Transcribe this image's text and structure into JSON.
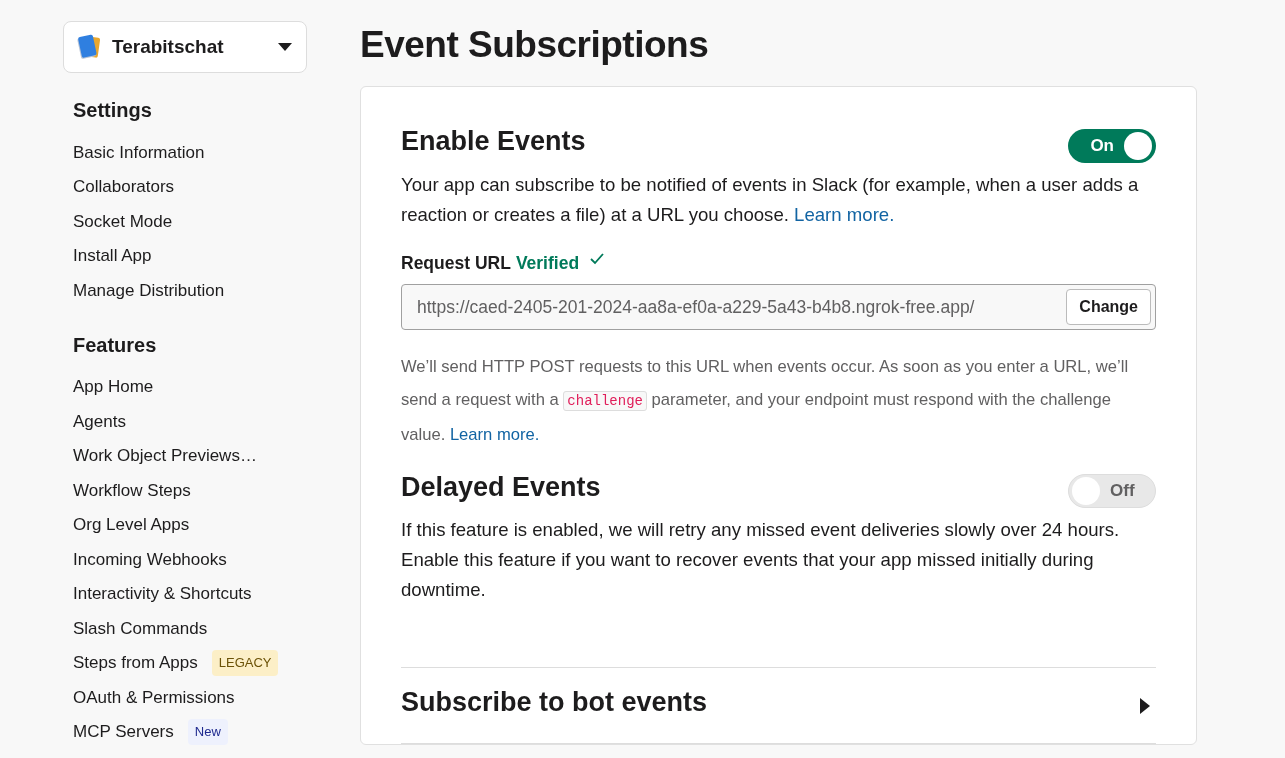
{
  "workspace": {
    "name": "Terabitschat"
  },
  "sidebar": {
    "sections": [
      {
        "title": "Settings",
        "items": [
          {
            "label": "Basic Information"
          },
          {
            "label": "Collaborators"
          },
          {
            "label": "Socket Mode"
          },
          {
            "label": "Install App"
          },
          {
            "label": "Manage Distribution"
          }
        ]
      },
      {
        "title": "Features",
        "items": [
          {
            "label": "App Home"
          },
          {
            "label": "Agents"
          },
          {
            "label": "Work Object Previews…"
          },
          {
            "label": "Workflow Steps"
          },
          {
            "label": "Org Level Apps"
          },
          {
            "label": "Incoming Webhooks"
          },
          {
            "label": "Interactivity & Shortcuts"
          },
          {
            "label": "Slash Commands"
          },
          {
            "label": "Steps from Apps",
            "badge": {
              "text": "LEGACY",
              "kind": "legacy"
            }
          },
          {
            "label": "OAuth & Permissions"
          },
          {
            "label": "MCP Servers",
            "badge": {
              "text": "New",
              "kind": "new"
            }
          }
        ]
      }
    ]
  },
  "page_title": "Event Subscriptions",
  "enable_events": {
    "title": "Enable Events",
    "toggle": {
      "on": true,
      "label": "On"
    },
    "description": [
      {
        "kind": "text",
        "text": "Your app can subscribe to be notified of events in Slack (for example, when a user adds a reaction or creates a file) at a URL you choose. "
      },
      {
        "kind": "link",
        "text": "Learn more."
      }
    ],
    "request_url": {
      "label": "Request URL",
      "status": "Verified",
      "value": "https://caed-2405-201-2024-aa8a-ef0a-a229-5a43-b4b8.ngrok-free.app/",
      "button": "Change"
    },
    "help": [
      {
        "kind": "text",
        "text": "We’ll send HTTP POST requests to this URL when events occur. As soon as you enter a URL, we’ll send a request with a "
      },
      {
        "kind": "code",
        "text": "challenge"
      },
      {
        "kind": "text",
        "text": " parameter, and your endpoint must respond with the challenge value. "
      },
      {
        "kind": "link",
        "text": "Learn more."
      }
    ]
  },
  "delayed_events": {
    "title": "Delayed Events",
    "toggle": {
      "on": false,
      "label": "Off"
    },
    "description": "If this feature is enabled, we will retry any missed event deliveries slowly over 24 hours. Enable this feature if you want to recover events that your app missed initially during downtime."
  },
  "subscribe_bot_events": {
    "title": "Subscribe to bot events",
    "expanded": false
  }
}
